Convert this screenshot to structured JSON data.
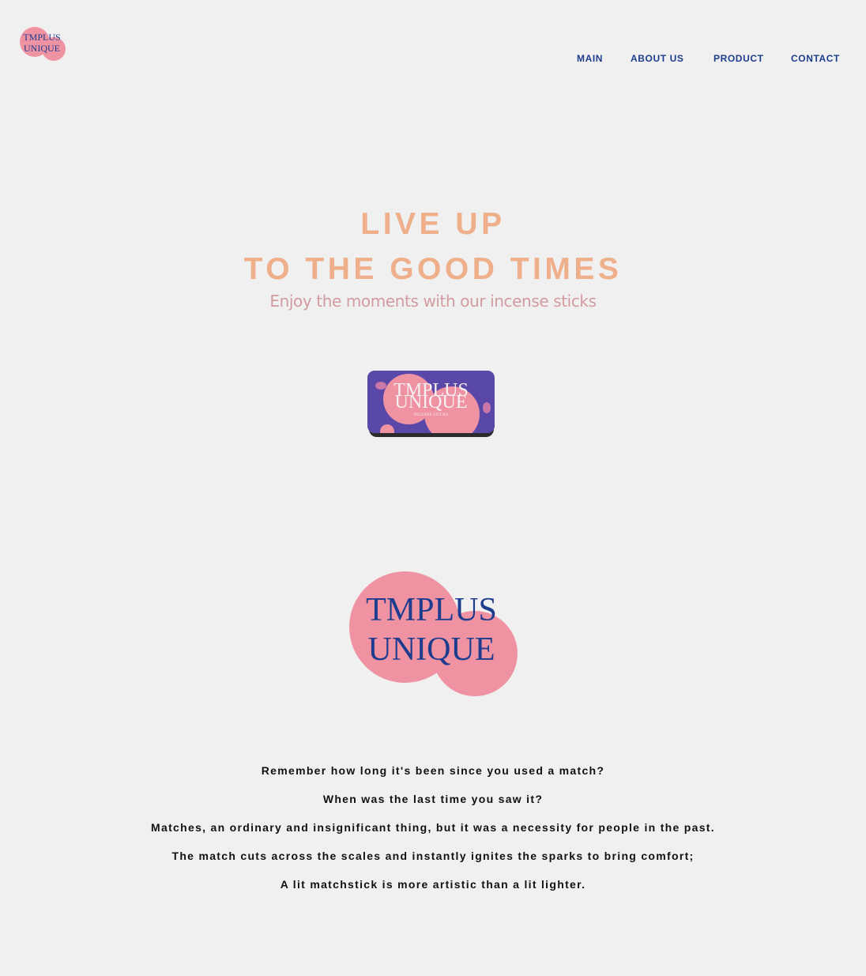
{
  "header": {
    "logo": {
      "line1": "TMPLUS",
      "line2": "UNIQUE"
    },
    "nav": [
      {
        "label": "MAIN"
      },
      {
        "label": "ABOUT US"
      },
      {
        "label": "PRODUCT"
      },
      {
        "label": "CONTACT"
      }
    ]
  },
  "hero": {
    "title_line1": "LIVE UP",
    "title_line2": "TO THE GOOD TIMES",
    "subtitle": "Enjoy the moments with our incense sticks"
  },
  "product": {
    "tin_line1": "TMPLUS",
    "tin_line2": "UNIQUE",
    "tin_small_text": "INCENSE STICKS"
  },
  "brand": {
    "line1": "TMPLUS",
    "line2": "UNIQUE"
  },
  "story": [
    "Remember how long it's been since you used a match?",
    "When was the last time you saw it?",
    "Matches, an ordinary and insignificant thing, but it was a necessity for people in the past.",
    "The match cuts across the scales and instantly ignites the sparks to bring comfort;",
    "A lit matchstick is more artistic than a lit lighter."
  ],
  "colors": {
    "background": "#f0f0f0",
    "nav_blue": "#1d3c8e",
    "hero_orange": "#eeaf8a",
    "subtitle_pink": "#d39b9f",
    "brand_pink": "#ef93a2",
    "tin_purple": "#5a48a8"
  }
}
